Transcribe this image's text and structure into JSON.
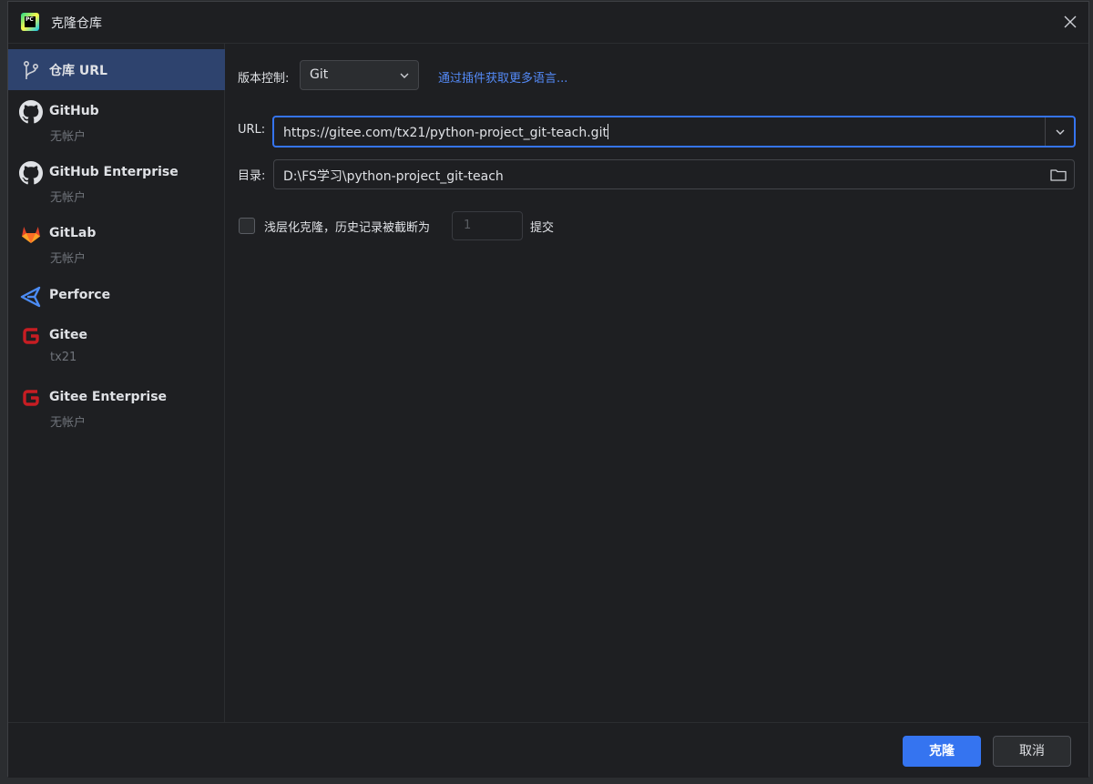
{
  "window": {
    "title": "克隆仓库",
    "icon": "pycharm-icon",
    "icon_text": "PC"
  },
  "sidebar": {
    "items": [
      {
        "label": "仓库 URL",
        "sub": "",
        "icon": "git-branch-icon",
        "selected": true
      },
      {
        "label": "GitHub",
        "sub": "无帐户",
        "icon": "github-icon"
      },
      {
        "label": "GitHub Enterprise",
        "sub": "无帐户",
        "icon": "github-icon"
      },
      {
        "label": "GitLab",
        "sub": "无帐户",
        "icon": "gitlab-icon"
      },
      {
        "label": "Perforce",
        "sub": "",
        "icon": "perforce-icon"
      },
      {
        "label": "Gitee",
        "sub": "tx21",
        "icon": "gitee-icon"
      },
      {
        "label": "Gitee Enterprise",
        "sub": "无帐户",
        "icon": "gitee-icon"
      }
    ]
  },
  "form": {
    "vcs_label": "版本控制:",
    "vcs_value": "Git",
    "plugin_link": "通过插件获取更多语言...",
    "url_label": "URL:",
    "url_value": "https://gitee.com/tx21/python-project_git-teach.git",
    "dir_label": "目录:",
    "dir_value": "D:\\FS学习\\python-project_git-teach",
    "shallow_label": "浅层化克隆，历史记录被截断为",
    "shallow_checked": false,
    "shallow_count": "1",
    "shallow_suffix": "提交"
  },
  "footer": {
    "clone_label": "克隆",
    "cancel_label": "取消"
  },
  "colors": {
    "background": "#1e1f22",
    "selection": "#2e436e",
    "accent": "#3574f0",
    "link": "#548af7",
    "gitlab": "#e24329",
    "gitee": "#c71d23",
    "perforce": "#4c8cf5"
  }
}
